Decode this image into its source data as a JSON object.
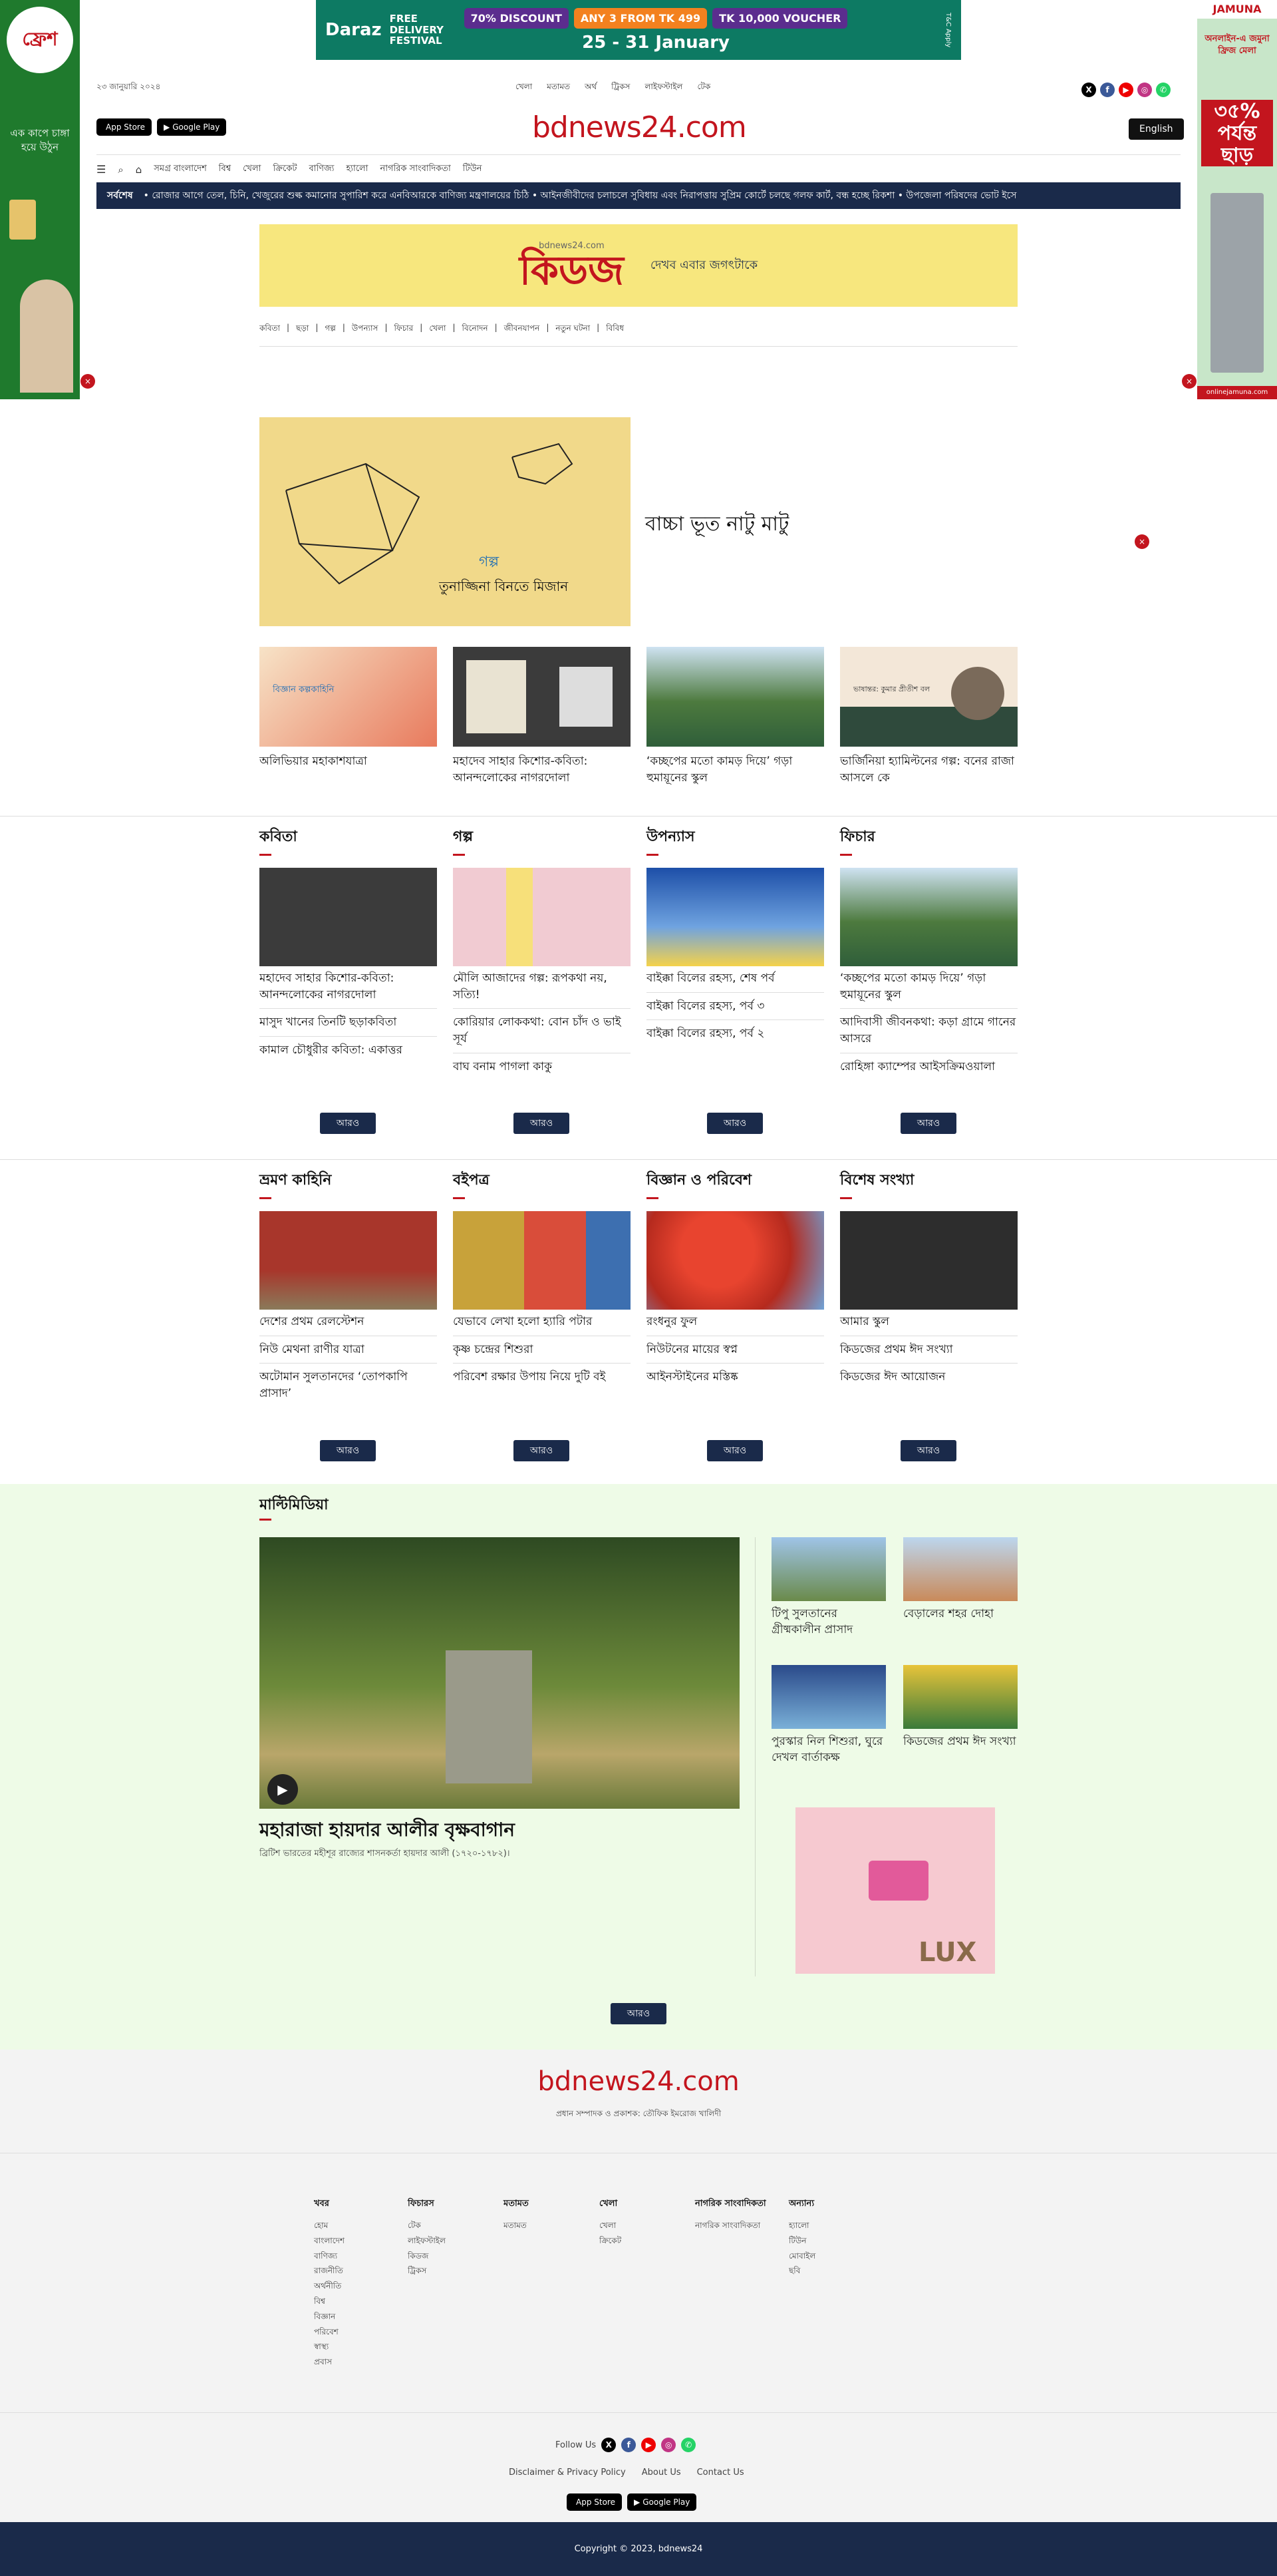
{
  "ads": {
    "top": {
      "brand": "Daraz",
      "free": "FREE DELIVERY FESTIVAL",
      "d1": "70% DISCOUNT",
      "d2": "ANY 3 FROM TK 499",
      "d3": "TK 10,000 VOUCHER",
      "date": "25 - 31 January",
      "tnc": "T&C Apply"
    },
    "left": {
      "brand": "ফ্রেশ",
      "tag": "এক কাপে চাঙ্গা হয়ে উঠুন"
    },
    "right": {
      "brand": "JAMUNA",
      "sub": "অনলাইন-এ জমুনা ফ্রিজ মেলা",
      "offer": "৩৫% পর্যন্ত ছাড়",
      "site": "onlinejamuna.com"
    },
    "lux": "LUX"
  },
  "header": {
    "date": "২৩ জানুয়ারি ২০২৪",
    "topnav": [
      "খেলা",
      "মতামত",
      "অর্থ",
      "ট্রিকস",
      "লাইফস্টাইল",
      "টেক"
    ],
    "brand": "bdnews24.com",
    "english": "English",
    "appstore": "App Store",
    "googleplay": "Google Play",
    "menu": [
      "সমগ্র বাংলাদেশ",
      "বিশ্ব",
      "খেলা",
      "ক্রিকেট",
      "বাণিজ্য",
      "হ্যালো",
      "নাগরিক সাংবাদিকতা",
      "টিউন"
    ],
    "ticker_label": "সর্বশেষ",
    "ticker": "•   রোজার আগে তেল, চিনি, খেজুরের শুল্ক কমানোর সুপারিশ করে এনবিআরকে বাণিজ্য মন্ত্রণালয়ের চিঠি   •   আইনজীবীদের চলাচলে সুবিধায় এবং নিরাপত্তায় সুপ্রিম কোর্টে চলছে গলফ কার্ট, বন্ধ হচ্ছে রিকশা   •   উপজেলা পরিষদের ভোট ইসে"
  },
  "kidz": {
    "site": "bdnews24.com",
    "logo": "কিডজ",
    "tagline": "দেখব এবার জগৎটাকে",
    "subnav": [
      "কবিতা",
      "ছড়া",
      "গল্প",
      "উপন্যাস",
      "ফিচার",
      "খেলা",
      "বিনোদন",
      "জীবনযাপন",
      "নতুন ঘটনা",
      "বিবিধ"
    ]
  },
  "lead": {
    "tag": "গল্প",
    "author": "তুনাজ্জিনা বিনতে মিজান",
    "title": "বাচ্চা ভূত নাটু মাটু"
  },
  "row": [
    {
      "title": "অলিভিয়ার মহাকাশযাত্রা",
      "img": "বিজ্ঞান কল্পকাহিনি"
    },
    {
      "title": "মহাদেব সাহার কিশোর-কবিতা: আনন্দলোকের নাগরদোলা",
      "img": ""
    },
    {
      "title": "‘কচ্ছপের মতো কামড় দিয়ে’ গড়া হুমায়ূনের স্কুল",
      "img": ""
    },
    {
      "title": "ভার্জিনিয়া হ্যামিল্টনের গল্প: বনের রাজা আসলে কে",
      "img": "ভাষান্তর: কুমার প্রীতীশ বল"
    }
  ],
  "sec1": [
    {
      "name": "কবিতা",
      "items": [
        "মহাদেব সাহার কিশোর-কবিতা: আনন্দলোকের নাগরদোলা",
        "মাসুদ খানের তিনটি ছড়াকবিতা",
        "কামাল চৌধুরীর কবিতা: একাত্তর"
      ]
    },
    {
      "name": "গল্প",
      "items": [
        "মৌলি আজাদের গল্প: রূপকথা নয়, সত্যি!",
        "কোরিয়ার লোককথা: বোন চাঁদ ও ভাই সূর্য",
        "বাঘ বনাম পাগলা কাকু"
      ]
    },
    {
      "name": "উপন্যাস",
      "items": [
        "বাইক্কা বিলের রহস্য, শেষ পর্ব",
        "বাইক্কা বিলের রহস্য, পর্ব ৩",
        "বাইক্কা বিলের রহস্য, পর্ব ২"
      ]
    },
    {
      "name": "ফিচার",
      "items": [
        "‘কচ্ছপের মতো কামড় দিয়ে’ গড়া হুমায়ূনের স্কুল",
        "আদিবাসী জীবনকথা: কড়া গ্রামে গানের আসরে",
        "রোহিঙ্গা ক্যাম্পের আইসক্রিমওয়ালা"
      ]
    }
  ],
  "sec2": [
    {
      "name": "ভ্রমণ কাহিনি",
      "items": [
        "দেশের প্রথম রেলস্টেশন",
        "নিউ মেথনা রাণীর যাত্রা",
        "অটোমান সুলতানদের ‘তোপকাপি প্রাসাদ’"
      ]
    },
    {
      "name": "বইপত্র",
      "items": [
        "যেভাবে লেখা হলো হ্যারি পটার",
        "কৃষ্ণ চন্দ্রের শিশুরা",
        "পরিবেশ রক্ষার উপায় নিয়ে দুটি বই"
      ]
    },
    {
      "name": "বিজ্ঞান ও পরিবেশ",
      "items": [
        "রংধনুর ফুল",
        "নিউটনের মায়ের স্বপ্ন",
        "আইনস্টাইনের মস্তিষ্ক"
      ]
    },
    {
      "name": "বিশেষ সংখ্যা",
      "items": [
        "আমার স্কুল",
        "কিডজের প্রথম ঈদ সংখ্যা",
        "কিডজের ঈদ আয়োজন"
      ]
    }
  ],
  "more": "আরও",
  "multimedia": {
    "title": "মাল্টিমিডিয়া",
    "main_title": "মহারাজা হায়দার আলীর বৃক্ষবাগান",
    "main_sub": "ব্রিটিশ ভারতের মহীশূর রাজ্যের শাসনকর্তা হায়দার আলী (১৭২০-১৭৮২)।",
    "items": [
      "টিপু সুলতানের গ্রীষ্মকালীন প্রাসাদ",
      "বেড়ালের শহর দোহা",
      "পুরস্কার নিল শিশুরা, ঘুরে দেখল বার্তাকক্ষ",
      "কিডজের প্রথম ঈদ সংখ্যা"
    ]
  },
  "footer": {
    "brand": "bdnews24.com",
    "editor": "প্রধান সম্পাদক ও প্রকাশক: তৌফিক ইমরোজ খালিদী",
    "cols": [
      {
        "h": "খবর",
        "items": [
          "হোম",
          "বাংলাদেশ",
          "বাণিজ্য",
          "রাজনীতি",
          "অর্থনীতি",
          "বিশ্ব",
          "বিজ্ঞান",
          "পরিবেশ",
          "স্বাস্থ্য",
          "প্রবাস"
        ]
      },
      {
        "h": "ফিচারস",
        "items": [
          "টেক",
          "লাইফস্টাইল",
          "কিডজ",
          "ট্রিকস"
        ]
      },
      {
        "h": "মতামত",
        "items": [
          "মতামত"
        ]
      },
      {
        "h": "খেলা",
        "items": [
          "খেলা",
          "ক্রিকেট"
        ]
      },
      {
        "h": "নাগরিক সাংবাদিকতা",
        "items": [
          "নাগরিক সাংবাদিকতা"
        ]
      },
      {
        "h": "অন্যান্য",
        "items": [
          "হ্যালো",
          "টিউন",
          "মোবাইল",
          "ছবি"
        ]
      }
    ],
    "follow": "Follow Us",
    "links": [
      "Disclaimer & Privacy Policy",
      "About Us",
      "Contact Us"
    ],
    "copyright": "Copyright © 2023, bdnews24"
  }
}
